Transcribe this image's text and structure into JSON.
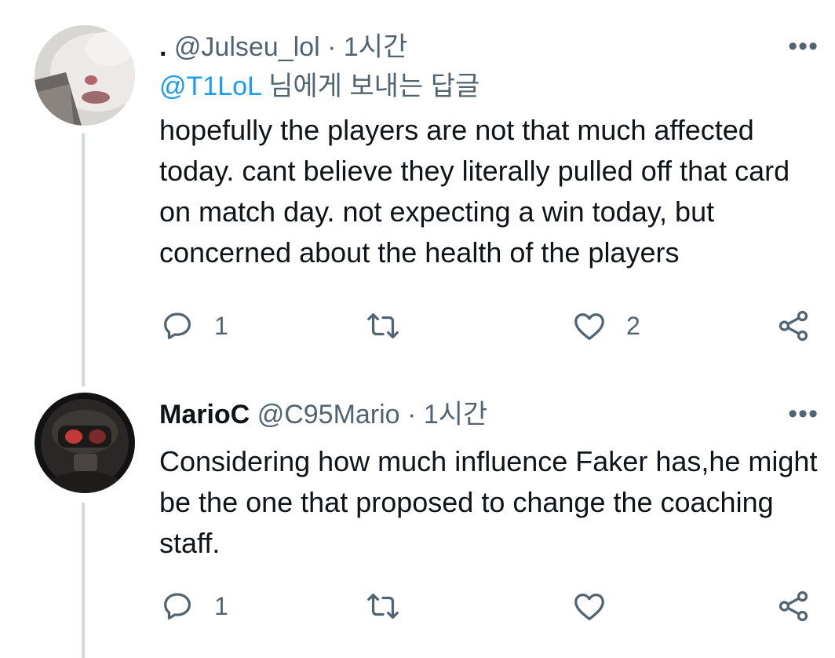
{
  "tweets": [
    {
      "display_name": ".",
      "handle": "@Julseu_lol",
      "time": "1시간",
      "replying_to_handle": "@T1LoL",
      "replying_to_suffix": " 님에게 보내는 답글",
      "text": "hopefully the players are not that much affected today. cant believe they literally pulled off that card on match day. not expecting a win today, but concerned about the health of the players",
      "reply_count": "1",
      "retweet_count": "",
      "like_count": "2",
      "more_label": "•••"
    },
    {
      "display_name": "MarioC",
      "handle": "@C95Mario",
      "time": "1시간",
      "text": "Considering how much influence Faker has,he might be the one that proposed to change the coaching staff.",
      "reply_count": "1",
      "retweet_count": "",
      "like_count": "",
      "more_label": "•••"
    }
  ],
  "separator": "·",
  "colors": {
    "text": "#0f1419",
    "muted": "#536471",
    "link": "#1d9bf0",
    "thread_line": "#cfd9de"
  },
  "icons": [
    "reply-icon",
    "retweet-icon",
    "like-icon",
    "share-icon",
    "more-icon"
  ]
}
